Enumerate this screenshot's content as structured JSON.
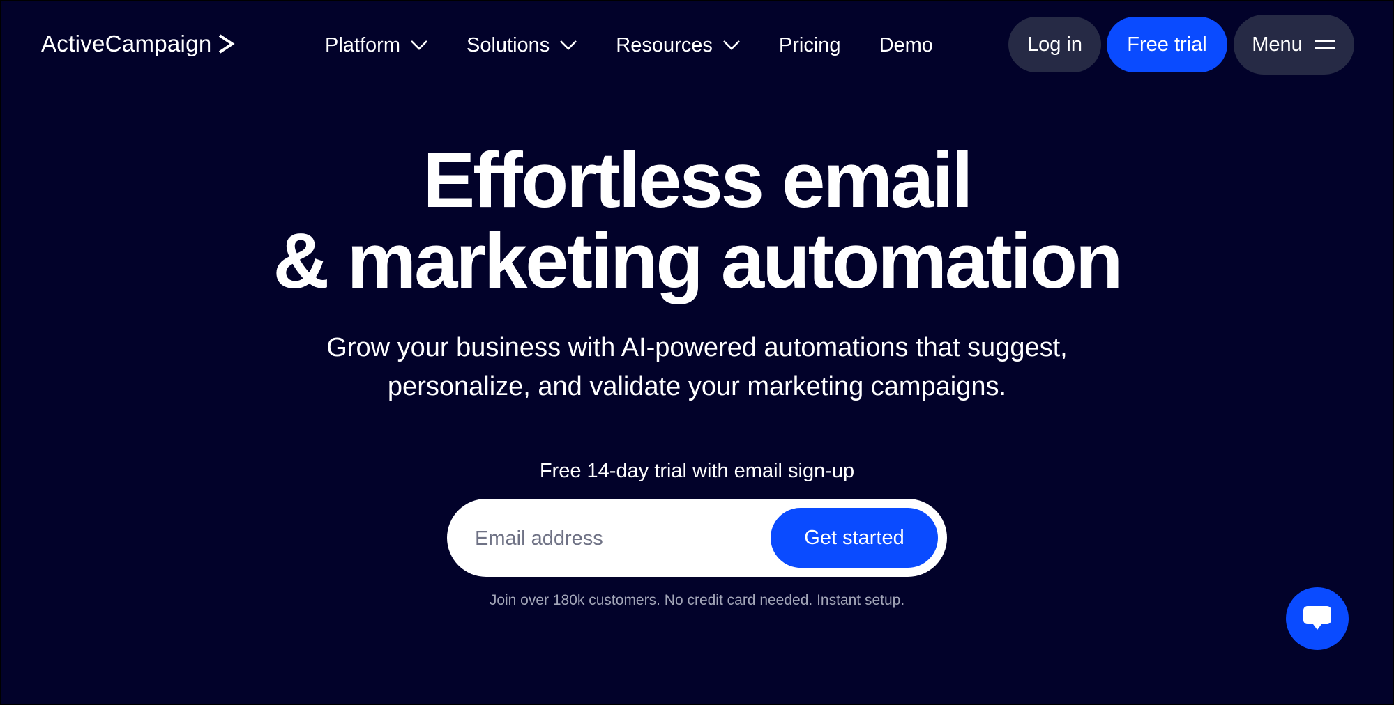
{
  "brand": {
    "logo_text": "ActiveCampaign",
    "accent_color": "#0a4bff",
    "background_color": "#02022a"
  },
  "nav": {
    "items": [
      {
        "label": "Platform",
        "has_dropdown": true
      },
      {
        "label": "Solutions",
        "has_dropdown": true
      },
      {
        "label": "Resources",
        "has_dropdown": true
      },
      {
        "label": "Pricing",
        "has_dropdown": false
      },
      {
        "label": "Demo",
        "has_dropdown": false
      }
    ]
  },
  "header_actions": {
    "login_label": "Log in",
    "free_trial_label": "Free trial",
    "menu_label": "Menu",
    "menu_icon": "hamburger-icon"
  },
  "hero": {
    "headline_line1": "Effortless email",
    "headline_line2": "& marketing automation",
    "subhead_line1": "Grow your business with AI-powered automations that suggest,",
    "subhead_line2": "personalize, and validate your marketing campaigns.",
    "trial_label": "Free 14-day trial with email sign-up",
    "email_placeholder": "Email address",
    "email_value": "",
    "cta_label": "Get started",
    "fineprint": "Join over 180k customers. No credit card needed. Instant setup."
  },
  "chat_widget": {
    "icon": "chat-bubble-icon"
  }
}
